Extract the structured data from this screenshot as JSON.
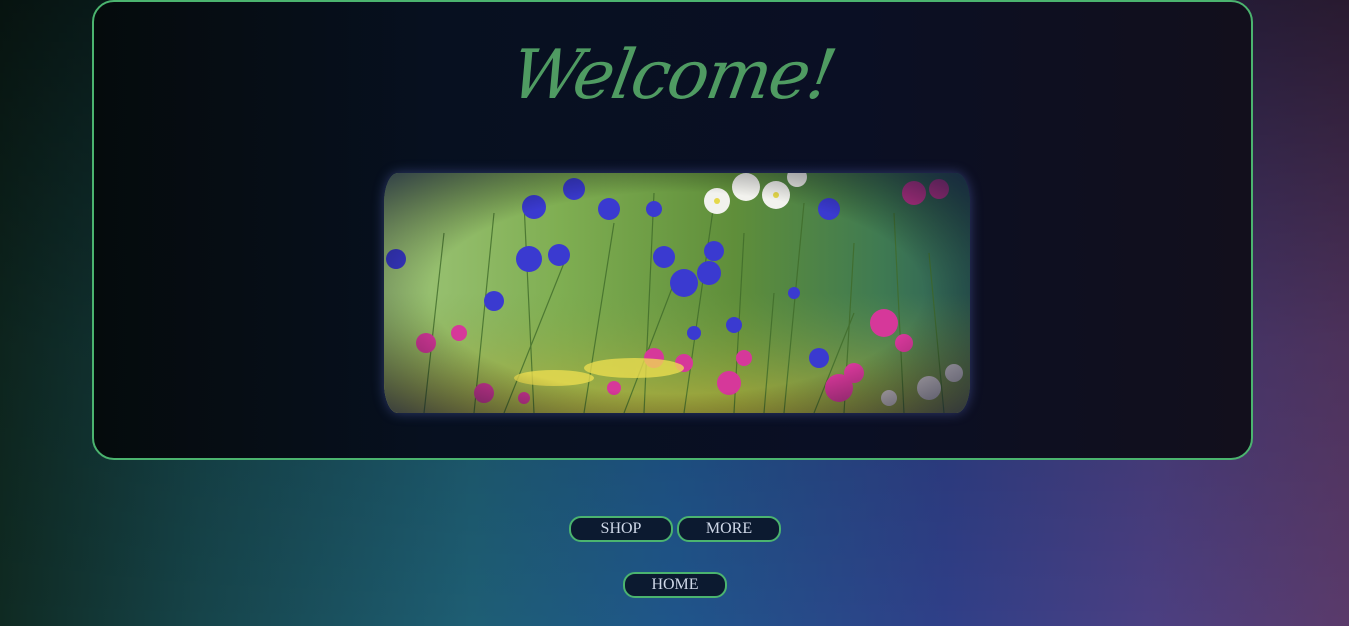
{
  "page": {
    "heading": "Welcome!",
    "image_alt": "wildflower-meadow-photo"
  },
  "nav": {
    "shop_label": "SHOP",
    "more_label": "MORE",
    "home_label": "HOME"
  },
  "colors": {
    "accent": "#4bb46f",
    "heading": "#4f9b62",
    "button_text": "#cfd8e8",
    "panel": "#07101e"
  }
}
